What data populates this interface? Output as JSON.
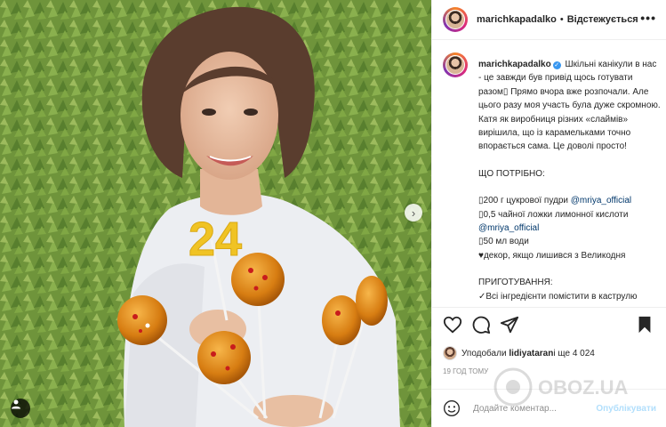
{
  "photo": {
    "number_decor": "24",
    "next_icon": "chevron-right-icon",
    "user_tag_icon": "user-icon"
  },
  "header": {
    "username": "marichkapadalko",
    "separator": "•",
    "follow_status": "Відстежується",
    "more_icon": "•••"
  },
  "caption": {
    "username": "marichkapadalko",
    "verified_icon": "verified-badge-icon",
    "lines": [
      "Шкільні канікули в нас - це завжди був привід щось готувати разом▯ Прямо вчора вже розпочали. Але цього разу моя участь була дуже скромною. Катя як виробниця різних «слаймів» вирішила, що із карамельками точно впорається сама. Це доволі просто!"
    ],
    "section_title": "ЩО ПОТРІБНО:",
    "ingredients": [
      {
        "text": "▯200 г цукрової пудри ",
        "tag": "@mriya_official"
      },
      {
        "text": "▯0,5 чайної ложки лимонної кислоти ",
        "tag": ""
      },
      {
        "text": "",
        "tag": "@mriya_official"
      },
      {
        "text": "▯50 мл води",
        "tag": ""
      },
      {
        "text": "♥декор, якщо лишився з Великодня",
        "tag": ""
      }
    ],
    "section_title_2": "ПРИГОТУВАННЯ:",
    "step_1": "✓Всі інгредієнти помістити в каструлю"
  },
  "actions": {
    "like_icon": "heart-icon",
    "comment_icon": "comment-icon",
    "share_icon": "share-icon",
    "save_icon": "bookmark-icon"
  },
  "likes": {
    "prefix": "Уподобали ",
    "user": "lidiyataran",
    "suffix": " і ще 4 024"
  },
  "timestamp": "19 год тому",
  "comment": {
    "emoji_icon": "smile-icon",
    "placeholder": "Додайте коментар...",
    "post_label": "Опублікувати"
  },
  "watermark": {
    "text": "OBOZ.UA"
  }
}
